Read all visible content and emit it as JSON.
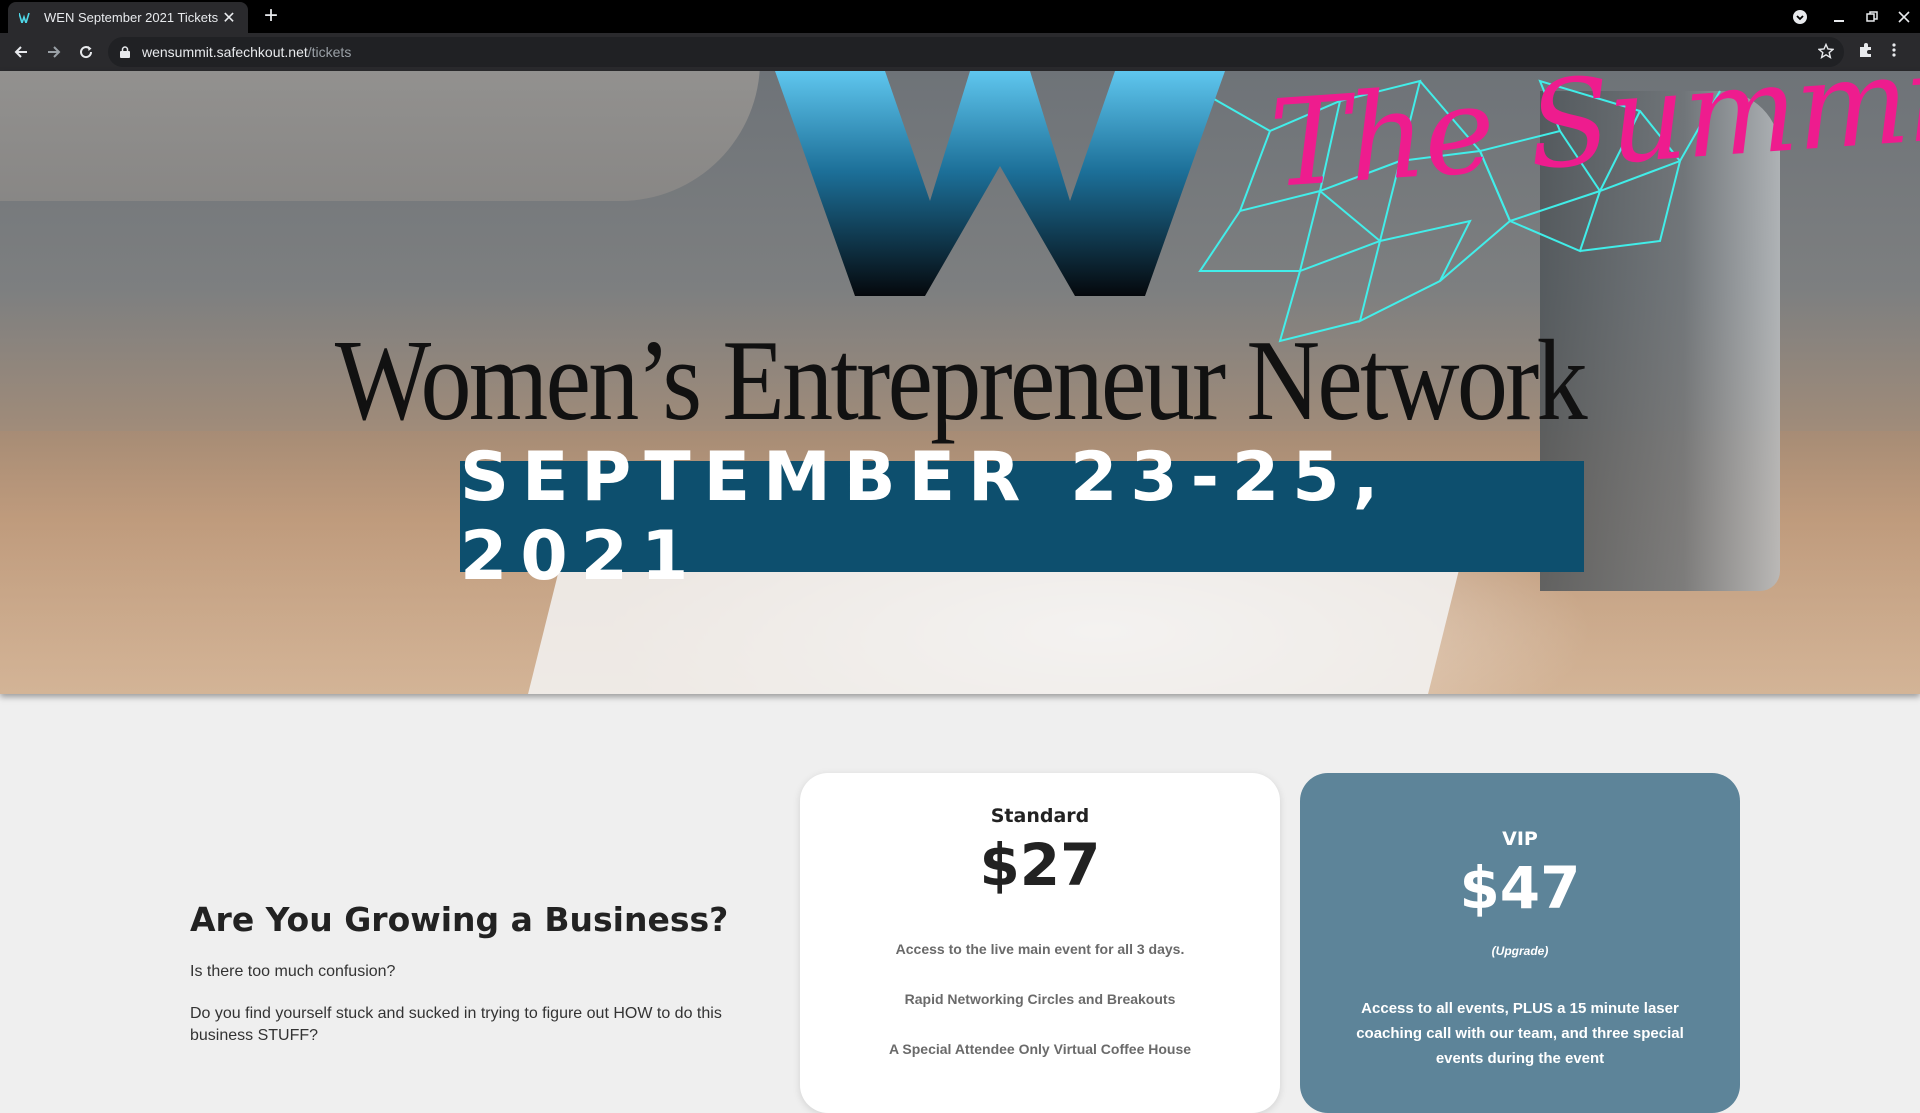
{
  "browser": {
    "tab_title": "WEN September 2021 Tickets",
    "url_host": "wensummit.safechkout.net",
    "url_path": "/tickets"
  },
  "hero": {
    "summit_script": "The Summit",
    "org_name": "Women’s Entrepreneur Network",
    "date": "SEPTEMBER 23-25, 2021",
    "colors": {
      "banner": "#0d4f6e",
      "script": "#ee1c8e",
      "network": "#3ff5f0"
    }
  },
  "intro": {
    "heading": "Are You Growing a Business?",
    "p1": "Is there too much confusion?",
    "p2": "Do you find yourself stuck and sucked in trying to figure out HOW to do this business STUFF?"
  },
  "tickets": {
    "standard": {
      "name": "Standard",
      "price": "$27",
      "features": [
        "Access to the live main event for all 3 days.",
        "Rapid Networking Circles and Breakouts",
        "A Special Attendee Only Virtual Coffee House"
      ]
    },
    "vip": {
      "name": "VIP",
      "price": "$47",
      "note": "(Upgrade)",
      "description": "Access to all events, PLUS a 15 minute laser coaching call with our team, and three special events during the event",
      "color": "#5d8499"
    }
  }
}
